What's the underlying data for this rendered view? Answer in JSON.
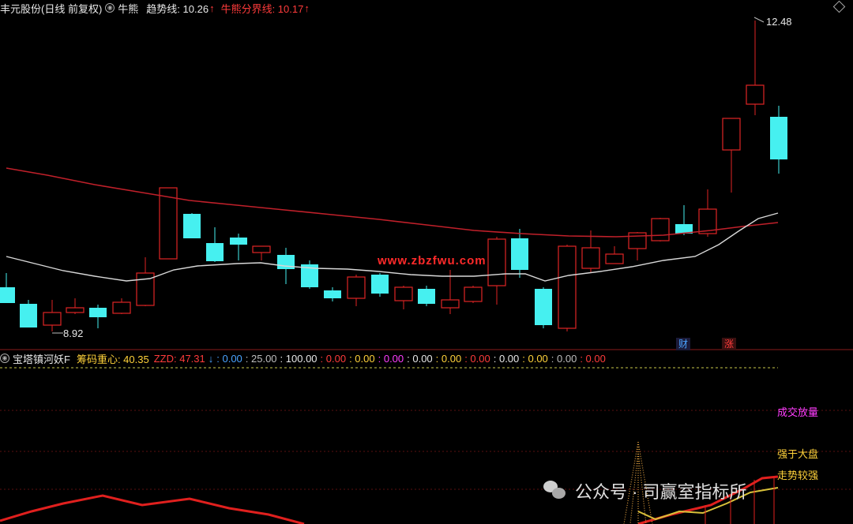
{
  "header": {
    "stock": "丰元股份(日线 前复权)",
    "indicator": "牛熊",
    "trend_label": "趋势线: 10.26",
    "divider_label": "牛熊分界线: 10.17",
    "up_arrow": "↑",
    "corner_icon": "diamond-icon"
  },
  "price_panel": {
    "high_label": "12.48",
    "low_label": "8.92",
    "site_watermark": "www.zbzfwu.com",
    "tag_cai": "财",
    "tag_zhang": "涨",
    "colors": {
      "up": "#e02424",
      "down": "#46f0f0",
      "ma_red": "#c0202a",
      "ma_white": "#d8d8d8"
    }
  },
  "indicator_header": {
    "name": "宝塔镇河妖F",
    "chip_label": "筹码重心: 40.35",
    "zzd_label": "ZZD: 47.31",
    "down_arrow": "↓",
    "values": [
      ": 0.00",
      ": 25.00",
      ": 100.00",
      ": 0.00",
      ": 0.00",
      ": 0.00",
      ": 0.00",
      ": 0.00",
      ": 0.00",
      ": 0.00",
      ": 0.00",
      ": 0.00",
      ": 0.00"
    ]
  },
  "indicator_panel": {
    "label_volume": "成交放量",
    "label_stronger": "强于大盘",
    "label_trend": "走势较强"
  },
  "watermark": {
    "text": "公众号 · 司赢室指标所"
  }
}
